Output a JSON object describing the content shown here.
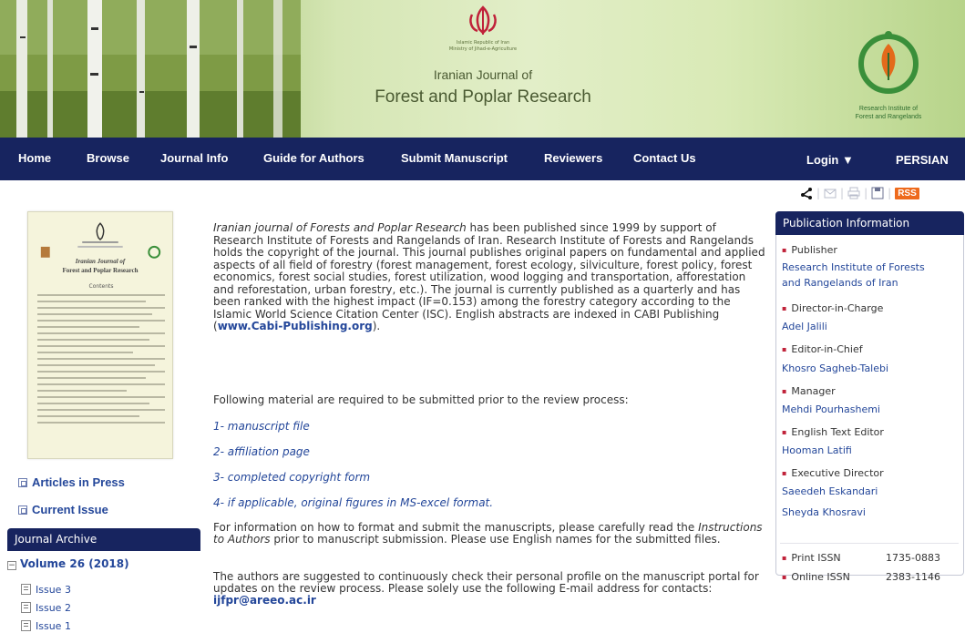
{
  "header": {
    "emblem_caption_line1": "Islamic Republic of Iran",
    "emblem_caption_line2": "Ministry of Jihad-e-Agriculture",
    "journal_line1": "Iranian Journal of",
    "journal_line2": "Forest and Poplar Research",
    "logo_caption_line1": "Research Institute of",
    "logo_caption_line2": "Forest and Rangelands"
  },
  "nav": {
    "items": [
      "Home",
      "Browse",
      "Journal Info",
      "Guide for Authors",
      "Submit Manuscript",
      "Reviewers",
      "Contact Us"
    ],
    "login": "Login ▼",
    "language": "PERSIAN"
  },
  "utils": {
    "rss": "RSS"
  },
  "cover": {
    "title1": "Iranian Journal of",
    "title2": "Forest and Poplar Research",
    "contents": "Contents"
  },
  "sidebar_left": {
    "articles_in_press": "Articles in Press",
    "current_issue": "Current Issue",
    "archive_title": "Journal Archive",
    "volume": "Volume 26 (2018)",
    "issues": [
      "Issue 3",
      "Issue 2",
      "Issue 1"
    ]
  },
  "main": {
    "intro_em": "Iranian journal of Forests and Poplar Research",
    "intro_text": " has been published since 1999 by support of Research Institute of Forests and Rangelands of Iran. Research Institute of Forests and Rangelands holds the copyright of the journal. This journal publishes original papers on fundamental and applied aspects of all field of forestry (forest management, forest ecology, silviculture, forest policy, forest economics, forest social studies, forest utilization, wood logging and transportation, afforestation and reforestation, urban forestry, etc.). The journal is currently published as a quarterly and has been ranked with the highest impact (IF=0.153) among the forestry category according to the Islamic World Science Citation Center (ISC). English abstracts are indexed in CABI Publishing (",
    "intro_link": "www.Cabi-Publishing.org",
    "intro_end": ").",
    "required_lead": "Following material are required to be submitted prior to the review process:",
    "required_items": [
      "1- manuscript file",
      "2- affiliation page",
      "3- completed copyright form",
      "4- if applicable, original figures in MS-excel format."
    ],
    "format_para_a": "For information on how to format and submit the manuscripts, please carefully read the ",
    "format_para_em": "Instructions to Authors",
    "format_para_b": " prior to manuscript submission. Please use English names for the submitted files.",
    "contact_para": "The authors are suggested to continuously check their personal profile on the manuscript portal for updates on the review process. Please solely use the following E-mail address for contacts: ",
    "email": "ijfpr@areeo.ac.ir"
  },
  "publication_info": {
    "title": "Publication Information",
    "publisher_label": "Publisher",
    "publisher_value_line1": "Research Institute of Forests",
    "publisher_value_line2": "and Rangelands of Iran",
    "director_label": "Director-in-Charge",
    "director_value": "Adel Jalili",
    "editor_label": "Editor-in-Chief",
    "editor_value": "Khosro Sagheb-Talebi",
    "manager_label": "Manager",
    "manager_value": "Mehdi Pourhashemi",
    "english_editor_label": "English Text Editor",
    "english_editor_value": "Hooman Latifi",
    "executive_label": "Executive Director",
    "executive_value1": "Saeedeh Eskandari",
    "executive_value2": "Sheyda Khosravi",
    "print_issn_label": "Print ISSN",
    "print_issn_value": "1735-0883",
    "online_issn_label": "Online ISSN",
    "online_issn_value": "2383-1146"
  }
}
